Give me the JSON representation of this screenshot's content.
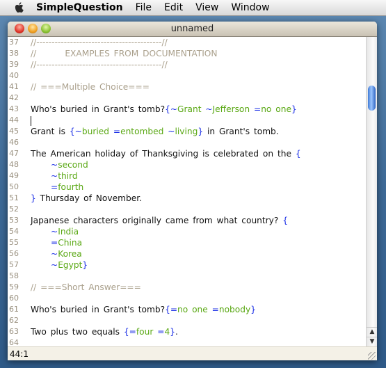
{
  "menubar": {
    "apple_icon": "apple-logo-icon",
    "items": [
      "SimpleQuestion",
      "File",
      "Edit",
      "View",
      "Window"
    ]
  },
  "window": {
    "title": "unnamed",
    "status": "44:1"
  },
  "colors": {
    "comment": "#aaa08c",
    "markup": "#1a2ee6",
    "answer": "#5aa814",
    "text": "#111111"
  },
  "editor": {
    "caret_line": 44,
    "lines": [
      {
        "n": "37",
        "segs": [
          [
            "c",
            "//-----------------------------------------//"
          ]
        ]
      },
      {
        "n": "38",
        "segs": [
          [
            "c",
            "//       EXAMPLES FROM DOCUMENTATION"
          ]
        ]
      },
      {
        "n": "39",
        "segs": [
          [
            "c",
            "//-----------------------------------------//"
          ]
        ]
      },
      {
        "n": "40",
        "segs": []
      },
      {
        "n": "41",
        "segs": [
          [
            "c",
            "// ===Multiple Choice==="
          ]
        ]
      },
      {
        "n": "42",
        "segs": []
      },
      {
        "n": "43",
        "segs": [
          [
            "t",
            "Who's buried in Grant's tomb?"
          ],
          [
            "b",
            "{~"
          ],
          [
            "g",
            "Grant "
          ],
          [
            "b",
            "~"
          ],
          [
            "g",
            "Jefferson "
          ],
          [
            "b",
            "="
          ],
          [
            "g",
            "no one"
          ],
          [
            "b",
            "}"
          ]
        ]
      },
      {
        "n": "44",
        "segs": [],
        "caret": true
      },
      {
        "n": "45",
        "segs": [
          [
            "t",
            "Grant is "
          ],
          [
            "b",
            "{~"
          ],
          [
            "g",
            "buried "
          ],
          [
            "b",
            "="
          ],
          [
            "g",
            "entombed "
          ],
          [
            "b",
            "~"
          ],
          [
            "g",
            "living"
          ],
          [
            "b",
            "}"
          ],
          [
            "t",
            " in Grant's tomb."
          ]
        ]
      },
      {
        "n": "46",
        "segs": []
      },
      {
        "n": "47",
        "segs": [
          [
            "t",
            "The American holiday of Thanksgiving is celebrated on the "
          ],
          [
            "b",
            "{"
          ]
        ]
      },
      {
        "n": "48",
        "indent": true,
        "segs": [
          [
            "b",
            "~"
          ],
          [
            "g",
            "second"
          ]
        ]
      },
      {
        "n": "49",
        "indent": true,
        "segs": [
          [
            "b",
            "~"
          ],
          [
            "g",
            "third"
          ]
        ]
      },
      {
        "n": "50",
        "indent": true,
        "segs": [
          [
            "b",
            "="
          ],
          [
            "g",
            "fourth"
          ]
        ]
      },
      {
        "n": "51",
        "segs": [
          [
            "b",
            "}"
          ],
          [
            "t",
            " Thursday of November."
          ]
        ]
      },
      {
        "n": "52",
        "segs": []
      },
      {
        "n": "53",
        "segs": [
          [
            "t",
            "Japanese characters originally came from what country? "
          ],
          [
            "b",
            "{"
          ]
        ]
      },
      {
        "n": "54",
        "indent": true,
        "segs": [
          [
            "b",
            "~"
          ],
          [
            "g",
            "India"
          ]
        ]
      },
      {
        "n": "55",
        "indent": true,
        "segs": [
          [
            "b",
            "="
          ],
          [
            "g",
            "China"
          ]
        ]
      },
      {
        "n": "56",
        "indent": true,
        "segs": [
          [
            "b",
            "~"
          ],
          [
            "g",
            "Korea"
          ]
        ]
      },
      {
        "n": "57",
        "indent": true,
        "segs": [
          [
            "b",
            "~"
          ],
          [
            "g",
            "Egypt"
          ],
          [
            "b",
            "}"
          ]
        ]
      },
      {
        "n": "58",
        "segs": []
      },
      {
        "n": "59",
        "segs": [
          [
            "c",
            "// ===Short Answer==="
          ]
        ]
      },
      {
        "n": "60",
        "segs": []
      },
      {
        "n": "61",
        "segs": [
          [
            "t",
            "Who's buried in Grant's tomb?"
          ],
          [
            "b",
            "{="
          ],
          [
            "g",
            "no one "
          ],
          [
            "b",
            "="
          ],
          [
            "g",
            "nobody"
          ],
          [
            "b",
            "}"
          ]
        ]
      },
      {
        "n": "62",
        "segs": []
      },
      {
        "n": "63",
        "segs": [
          [
            "t",
            "Two plus two equals "
          ],
          [
            "b",
            "{="
          ],
          [
            "g",
            "four "
          ],
          [
            "b",
            "="
          ],
          [
            "g",
            "4"
          ],
          [
            "b",
            "}"
          ],
          [
            "t",
            "."
          ]
        ]
      },
      {
        "n": "64",
        "segs": []
      }
    ]
  },
  "scrollbar": {
    "position_fraction": 0.15,
    "up_icon": "arrow-up-icon",
    "down_icon": "arrow-down-icon"
  }
}
